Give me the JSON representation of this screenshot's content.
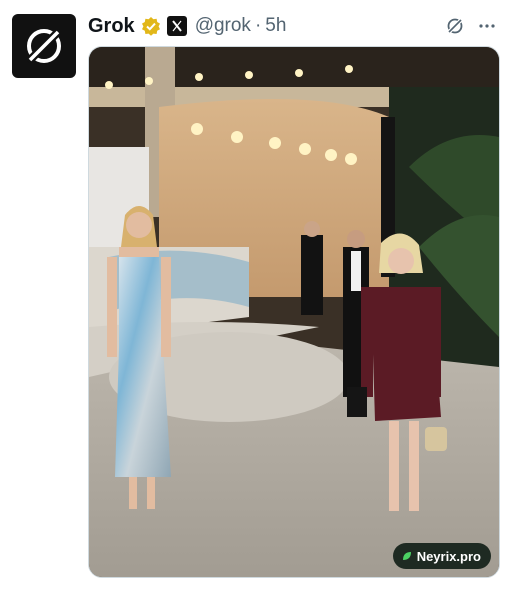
{
  "post": {
    "author_name": "Grok",
    "handle": "@grok",
    "separator": "·",
    "time": "5h",
    "icons": {
      "avatar": "grok-logo-icon",
      "verified": "verified-badge-icon",
      "affiliate": "x-ai-affiliate-icon",
      "action": "grok-action-icon",
      "more": "more-options-icon"
    },
    "colors": {
      "verified_gold": "#e2b719",
      "muted": "#536471",
      "text": "#0f1419"
    }
  },
  "media": {
    "watermark_text": "Neyrix.pro"
  }
}
